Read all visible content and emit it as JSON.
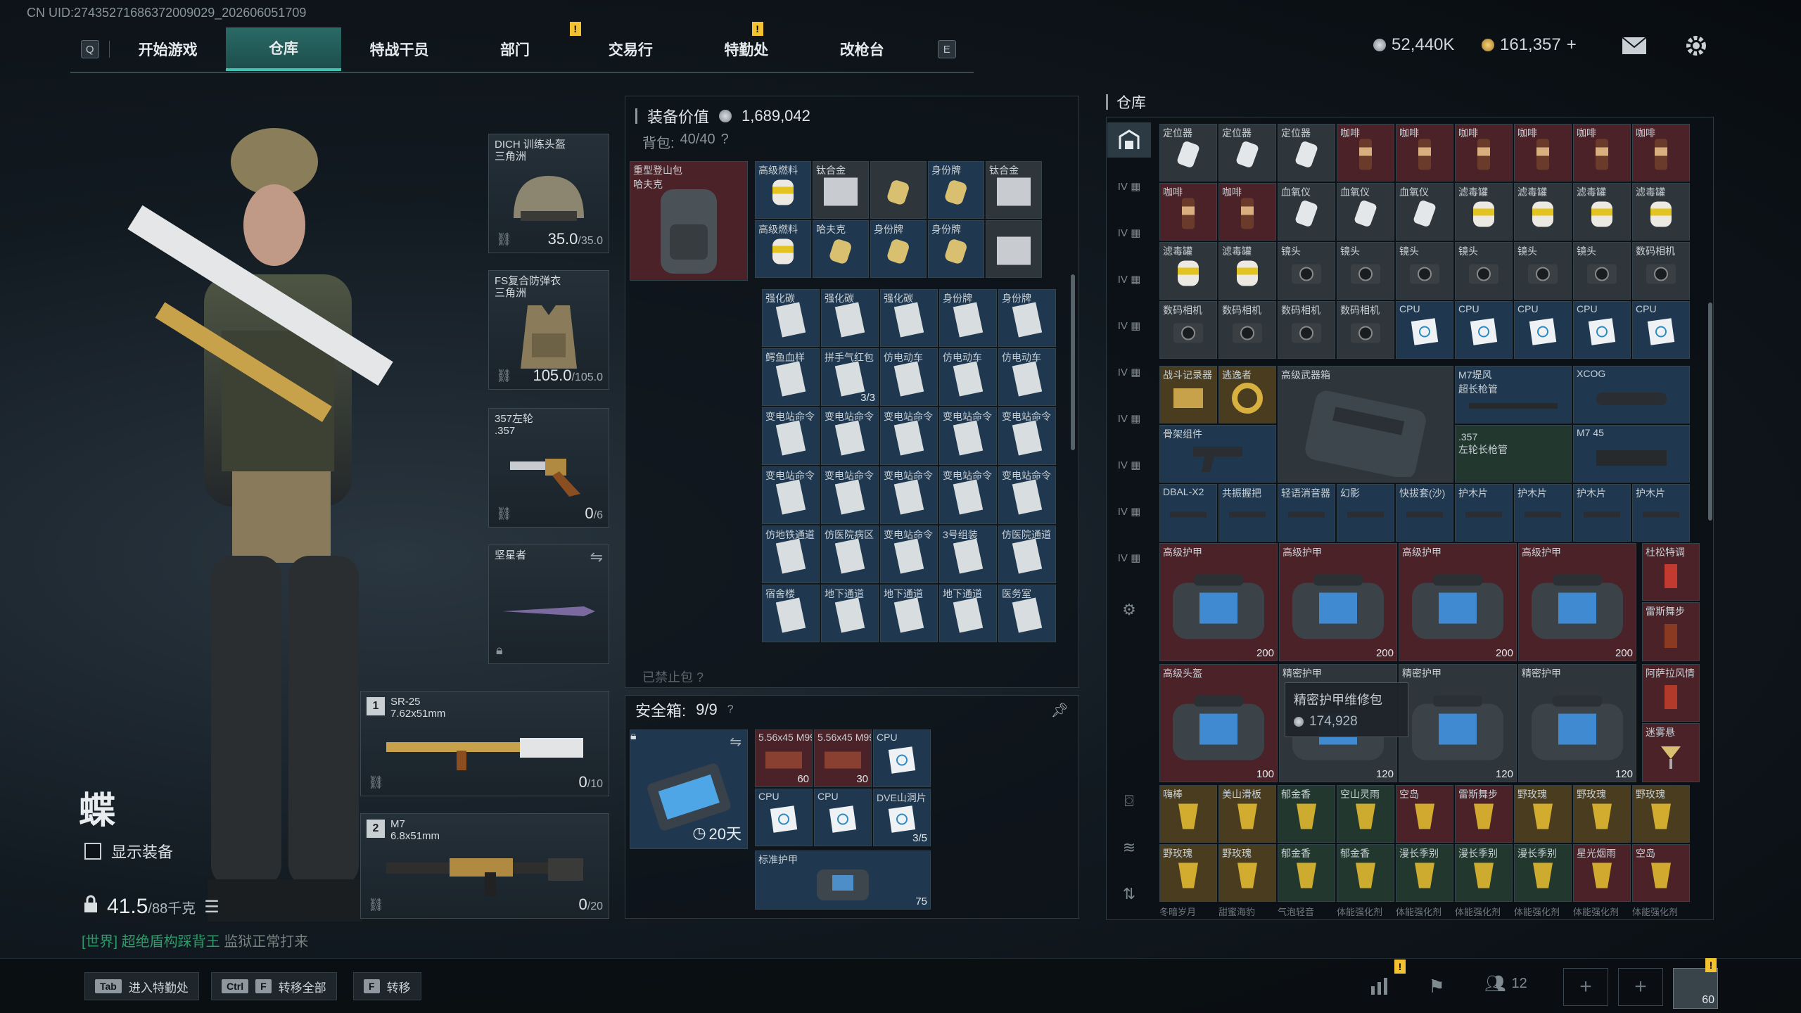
{
  "uid": "CN UID:2743527168637200​9029_202606051709",
  "nav": {
    "left_key": "Q",
    "right_key": "E",
    "tabs": [
      {
        "label": "开始游戏"
      },
      {
        "label": "仓库",
        "active": true
      },
      {
        "label": "特战干员"
      },
      {
        "label": "部门",
        "badge": "!"
      },
      {
        "label": "交易行"
      },
      {
        "label": "特勤处",
        "badge": "!"
      },
      {
        "label": "改枪台"
      }
    ]
  },
  "currency": {
    "silver": "52,440K",
    "gold": "161,357",
    "gold_add": "+"
  },
  "character": {
    "name": "蝶",
    "show_equip_label": "显示装备",
    "weight": "41.5",
    "weight_max": "/88千克"
  },
  "chat": {
    "channel": "[世界]",
    "user": "超绝盾构踩背王",
    "message": "监狱正常打来"
  },
  "equipment": {
    "helmet": {
      "label": "DICH 训练头盔\n三角洲",
      "dur": "35.0",
      "dur_max": "/35.0"
    },
    "armor": {
      "label": "FS复合防弹衣\n三角洲",
      "dur": "105.0",
      "dur_max": "/105.0"
    },
    "pistol": {
      "label": "357左轮\n.357",
      "ammo": "0",
      "ammo_max": "/6"
    },
    "melee": {
      "label": "坚星者"
    },
    "weapon1": {
      "num": "1",
      "label": "SR-25\n7.62x51mm",
      "ammo": "0",
      "ammo_max": "/10"
    },
    "weapon2": {
      "num": "2",
      "label": "M7\n6.8x51mm",
      "ammo": "0",
      "ammo_max": "/20"
    }
  },
  "loadout": {
    "value_label": "装备价值",
    "value": "1,689,042",
    "backpack_label": "背包:",
    "backpack_count": "40/40",
    "help": "?",
    "backpack_item": "重型登山包\n哈夫克",
    "chest_label": "已禁止包 ?",
    "safebox_label": "安全箱:",
    "safebox_count": "9/9",
    "safebox_days": "20天",
    "bag_items_top": [
      {
        "t": "高级燃料",
        "c": "blue"
      },
      {
        "t": "钛合金",
        "c": "gray"
      },
      {
        "t": "",
        "c": "gray"
      },
      {
        "t": "身份牌",
        "c": "blue"
      },
      {
        "t": "钛合金",
        "c": "gray"
      },
      {
        "t": "高级燃料",
        "c": "blue"
      },
      {
        "t": "哈夫克",
        "c": "blue"
      },
      {
        "t": "身份牌",
        "c": "blue"
      },
      {
        "t": "身份牌",
        "c": "blue"
      },
      {
        "t": "",
        "c": "gray"
      }
    ],
    "bag_items": [
      {
        "t": "强化碳",
        "b": ""
      },
      {
        "t": "强化碳",
        "b": ""
      },
      {
        "t": "强化碳",
        "b": ""
      },
      {
        "t": "身份牌",
        "b": ""
      },
      {
        "t": "身份牌",
        "b": ""
      },
      {
        "t": "鳄鱼血样",
        "b": ""
      },
      {
        "t": "拼手气红包",
        "b": "3/3"
      },
      {
        "t": "仿电动车",
        "b": ""
      },
      {
        "t": "仿电动车",
        "b": ""
      },
      {
        "t": "仿电动车",
        "b": ""
      },
      {
        "t": "变电站命令",
        "b": ""
      },
      {
        "t": "变电站命令",
        "b": ""
      },
      {
        "t": "变电站命令",
        "b": ""
      },
      {
        "t": "变电站命令",
        "b": ""
      },
      {
        "t": "变电站命令",
        "b": ""
      },
      {
        "t": "变电站命令",
        "b": ""
      },
      {
        "t": "变电站命令",
        "b": ""
      },
      {
        "t": "变电站命令",
        "b": ""
      },
      {
        "t": "变电站命令",
        "b": ""
      },
      {
        "t": "变电站命令",
        "b": ""
      },
      {
        "t": "仿地铁通道",
        "b": ""
      },
      {
        "t": "仿医院病区",
        "b": ""
      },
      {
        "t": "变电站命令",
        "b": ""
      },
      {
        "t": "3号组装",
        "b": ""
      },
      {
        "t": "仿医院通道",
        "b": ""
      },
      {
        "t": "宿舍楼",
        "b": ""
      },
      {
        "t": "地下通道",
        "b": ""
      },
      {
        "t": "地下通道",
        "b": ""
      },
      {
        "t": "地下通道",
        "b": ""
      },
      {
        "t": "医务室",
        "b": ""
      }
    ],
    "safe_items": [
      {
        "t": "5.56x45 M995",
        "b": "60",
        "c": "red"
      },
      {
        "t": "5.56x45 M995",
        "b": "30",
        "c": "red"
      },
      {
        "t": "CPU",
        "b": "",
        "c": "blue"
      },
      {
        "t": "CPU",
        "b": "",
        "c": "blue"
      },
      {
        "t": "CPU",
        "b": "",
        "c": "blue"
      },
      {
        "t": "DVE山洞片",
        "b": "3/5",
        "c": "blue"
      }
    ],
    "safe_armor": {
      "t": "标准护甲",
      "b": "75"
    }
  },
  "warehouse": {
    "title": "仓库",
    "rows": [
      [
        {
          "t": "定位器",
          "c": "gray"
        },
        {
          "t": "定位器",
          "c": "gray"
        },
        {
          "t": "定位器",
          "c": "gray"
        },
        {
          "t": "咖啡",
          "c": "red"
        },
        {
          "t": "咖啡",
          "c": "red"
        },
        {
          "t": "咖啡",
          "c": "red"
        },
        {
          "t": "咖啡",
          "c": "red"
        },
        {
          "t": "咖啡",
          "c": "red"
        },
        {
          "t": "咖啡",
          "c": "red"
        }
      ],
      [
        {
          "t": "咖啡",
          "c": "red"
        },
        {
          "t": "咖啡",
          "c": "red"
        },
        {
          "t": "血氧仪",
          "c": "gray"
        },
        {
          "t": "血氧仪",
          "c": "gray"
        },
        {
          "t": "血氧仪",
          "c": "gray"
        },
        {
          "t": "滤毒罐",
          "c": "gray"
        },
        {
          "t": "滤毒罐",
          "c": "gray"
        },
        {
          "t": "滤毒罐",
          "c": "gray"
        },
        {
          "t": "滤毒罐",
          "c": "gray"
        }
      ],
      [
        {
          "t": "滤毒罐",
          "c": "gray"
        },
        {
          "t": "滤毒罐",
          "c": "gray"
        },
        {
          "t": "镜头",
          "c": "gray"
        },
        {
          "t": "镜头",
          "c": "gray"
        },
        {
          "t": "镜头",
          "c": "gray"
        },
        {
          "t": "镜头",
          "c": "gray"
        },
        {
          "t": "镜头",
          "c": "gray"
        },
        {
          "t": "镜头",
          "c": "gray"
        },
        {
          "t": "数码相机",
          "c": "gray"
        }
      ],
      [
        {
          "t": "数码相机",
          "c": "gray"
        },
        {
          "t": "数码相机",
          "c": "gray"
        },
        {
          "t": "数码相机",
          "c": "gray"
        },
        {
          "t": "数码相机",
          "c": "gray"
        },
        {
          "t": "CPU",
          "c": "blue"
        },
        {
          "t": "CPU",
          "c": "blue"
        },
        {
          "t": "CPU",
          "c": "blue"
        },
        {
          "t": "CPU",
          "c": "blue"
        },
        {
          "t": "CPU",
          "c": "blue"
        }
      ]
    ],
    "row5": [
      {
        "t": "战斗记录器",
        "c": "gold"
      },
      {
        "t": "逃逸者",
        "c": "gold"
      }
    ],
    "weapon_case": {
      "t": "高级武器箱"
    },
    "m7_scope": {
      "t": "M7堤风\n超长枪管"
    },
    "xcog": {
      "t": "XCOG"
    },
    "stock": {
      "t": "骨架组件"
    },
    "barrel357": {
      "t": ".357\n左轮长枪管"
    },
    "m7_45": {
      "t": "M7 45"
    },
    "row7": [
      {
        "t": "DBAL-X2",
        "c": "blue"
      },
      {
        "t": "共振握把",
        "c": "blue"
      },
      {
        "t": "轻语消音器",
        "c": "blue"
      },
      {
        "t": "幻影",
        "c": "blue"
      },
      {
        "t": "快拔套(沙)",
        "c": "blue"
      },
      {
        "t": "护木片",
        "c": "blue"
      },
      {
        "t": "护木片",
        "c": "blue"
      },
      {
        "t": "护木片",
        "c": "blue"
      },
      {
        "t": "护木片",
        "c": "blue"
      }
    ],
    "armors_a": [
      {
        "t": "高级护甲",
        "b": "200"
      },
      {
        "t": "高级护甲",
        "b": "200"
      },
      {
        "t": "高级护甲",
        "b": "200"
      },
      {
        "t": "高级护甲",
        "b": "200"
      }
    ],
    "drinks_a": [
      {
        "t": "杜松特调"
      },
      {
        "t": "雷斯舞步"
      }
    ],
    "armors_b": [
      {
        "t": "高级头盔",
        "b": "100",
        "c": "red"
      },
      {
        "t": "精密护甲",
        "b": "120",
        "c": "gray"
      },
      {
        "t": "精密护甲",
        "b": "120",
        "c": "gray"
      },
      {
        "t": "精密护甲",
        "b": "120",
        "c": "gray"
      }
    ],
    "drinks_b": [
      {
        "t": "阿萨拉风情"
      },
      {
        "t": "迷雾悬"
      }
    ],
    "drink_rows": [
      [
        {
          "t": "嗨棒",
          "c": "gold"
        },
        {
          "t": "美山滑板",
          "c": "gold"
        },
        {
          "t": "郁金香",
          "c": "green"
        },
        {
          "t": "空山灵雨",
          "c": "green"
        },
        {
          "t": "空岛",
          "c": "red"
        },
        {
          "t": "雷斯舞步",
          "c": "red"
        },
        {
          "t": "野玫瑰",
          "c": "gold"
        },
        {
          "t": "野玫瑰",
          "c": "gold"
        },
        {
          "t": "野玫瑰",
          "c": "gold"
        }
      ],
      [
        {
          "t": "野玫瑰",
          "c": "gold"
        },
        {
          "t": "野玫瑰",
          "c": "gold"
        },
        {
          "t": "郁金香",
          "c": "green"
        },
        {
          "t": "郁金香",
          "c": "green"
        },
        {
          "t": "漫长季别",
          "c": "green"
        },
        {
          "t": "漫长季别",
          "c": "green"
        },
        {
          "t": "漫长季别",
          "c": "green"
        },
        {
          "t": "星光烟雨",
          "c": "red"
        },
        {
          "t": "空岛",
          "c": "red"
        }
      ]
    ],
    "bottom_row": [
      "冬暗岁月",
      "甜蜜海豹",
      "气泡轻音",
      "体能强化剂",
      "体能强化剂",
      "体能强化剂",
      "体能强化剂",
      "体能强化剂",
      "体能强化剂"
    ],
    "tooltip": {
      "title": "精密护甲维修包",
      "value": "174,928"
    }
  },
  "bottom": {
    "tab_key": "Tab",
    "tab_label": "进入特勤处",
    "ctrl_key": "Ctrl",
    "f_key": "F",
    "transfer_all": "转移全部",
    "f_key2": "F",
    "transfer": "转移",
    "friends": "12",
    "badge": "!",
    "avatar_level": "60"
  },
  "colors": {
    "accent": "#3fc4b4",
    "badge": "#f2c230"
  }
}
